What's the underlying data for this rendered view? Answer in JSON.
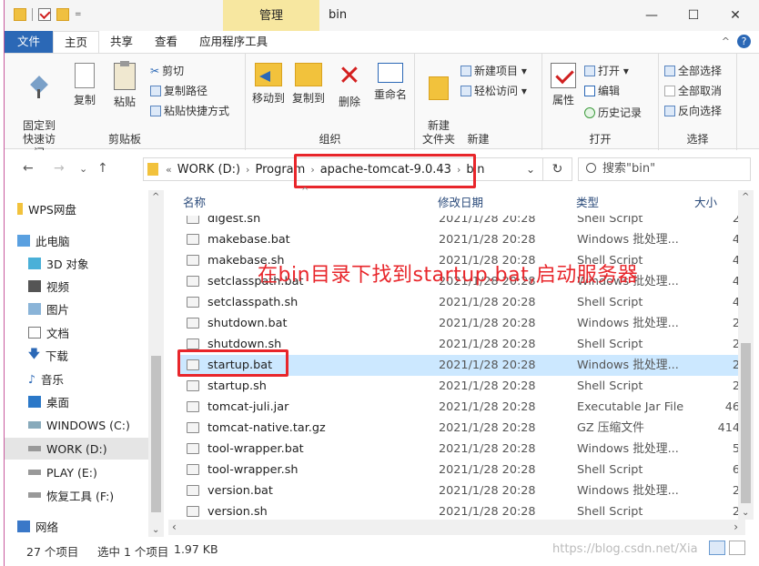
{
  "titlebar": {
    "context_tab": "管理",
    "title": "bin",
    "minimize": "—",
    "maximize": "☐",
    "close": "✕"
  },
  "ribbon_tabs": [
    "文件",
    "主页",
    "共享",
    "查看",
    "应用程序工具"
  ],
  "ribbon": {
    "clipboard": {
      "label": "剪贴板",
      "pin": "固定到\n快速访问",
      "copy": "复制",
      "paste": "粘贴",
      "cut": "剪切",
      "copy_path": "复制路径",
      "paste_shortcut": "粘贴快捷方式"
    },
    "organize": {
      "label": "组织",
      "move_to": "移动到",
      "copy_to": "复制到",
      "delete": "删除",
      "rename": "重命名"
    },
    "new": {
      "label": "新建",
      "new_folder": "新建\n文件夹",
      "new_item": "新建项目 ▾",
      "easy_access": "轻松访问 ▾"
    },
    "open": {
      "label": "打开",
      "properties": "属性",
      "open": "打开 ▾",
      "edit": "编辑",
      "history": "历史记录"
    },
    "select": {
      "label": "选择",
      "select_all": "全部选择",
      "select_none": "全部取消",
      "invert": "反向选择"
    }
  },
  "address": {
    "crumbs": [
      "WORK (D:)",
      "Program",
      "apache-tomcat-9.0.43",
      "bin"
    ],
    "search_placeholder": "搜索\"bin\""
  },
  "nav_items": [
    {
      "label": "WPS网盘",
      "icon": "wps-cloud-icon"
    },
    {
      "label": "此电脑",
      "icon": "computer-icon"
    },
    {
      "label": "3D 对象",
      "icon": "3d-objects-icon"
    },
    {
      "label": "视频",
      "icon": "video-icon"
    },
    {
      "label": "图片",
      "icon": "pictures-icon"
    },
    {
      "label": "文档",
      "icon": "documents-icon"
    },
    {
      "label": "下载",
      "icon": "download-icon"
    },
    {
      "label": "音乐",
      "icon": "music-icon"
    },
    {
      "label": "桌面",
      "icon": "desktop-icon"
    },
    {
      "label": "WINDOWS (C:)",
      "icon": "drive-icon"
    },
    {
      "label": "WORK (D:)",
      "icon": "drive-icon"
    },
    {
      "label": "PLAY (E:)",
      "icon": "drive-icon"
    },
    {
      "label": "恢复工具 (F:)",
      "icon": "drive-icon"
    },
    {
      "label": "网络",
      "icon": "network-icon"
    }
  ],
  "columns": {
    "name": "名称",
    "date": "修改日期",
    "type": "类型",
    "size": "大小"
  },
  "files": [
    {
      "name": "digest.sh",
      "date": "2021/1/28 20:28",
      "type": "Shell Script",
      "size": "2"
    },
    {
      "name": "makebase.bat",
      "date": "2021/1/28 20:28",
      "type": "Windows 批处理...",
      "size": "4"
    },
    {
      "name": "makebase.sh",
      "date": "2021/1/28 20:28",
      "type": "Shell Script",
      "size": "4"
    },
    {
      "name": "setclasspath.bat",
      "date": "2021/1/28 20:28",
      "type": "Windows 批处理...",
      "size": "4"
    },
    {
      "name": "setclasspath.sh",
      "date": "2021/1/28 20:28",
      "type": "Shell Script",
      "size": "4"
    },
    {
      "name": "shutdown.bat",
      "date": "2021/1/28 20:28",
      "type": "Windows 批处理...",
      "size": "2"
    },
    {
      "name": "shutdown.sh",
      "date": "2021/1/28 20:28",
      "type": "Shell Script",
      "size": "2"
    },
    {
      "name": "startup.bat",
      "date": "2021/1/28 20:28",
      "type": "Windows 批处理...",
      "size": "2"
    },
    {
      "name": "startup.sh",
      "date": "2021/1/28 20:28",
      "type": "Shell Script",
      "size": "2"
    },
    {
      "name": "tomcat-juli.jar",
      "date": "2021/1/28 20:28",
      "type": "Executable Jar File",
      "size": "46"
    },
    {
      "name": "tomcat-native.tar.gz",
      "date": "2021/1/28 20:28",
      "type": "GZ 压缩文件",
      "size": "414"
    },
    {
      "name": "tool-wrapper.bat",
      "date": "2021/1/28 20:28",
      "type": "Windows 批处理...",
      "size": "5"
    },
    {
      "name": "tool-wrapper.sh",
      "date": "2021/1/28 20:28",
      "type": "Shell Script",
      "size": "6"
    },
    {
      "name": "version.bat",
      "date": "2021/1/28 20:28",
      "type": "Windows 批处理...",
      "size": "2"
    },
    {
      "name": "version.sh",
      "date": "2021/1/28 20:28",
      "type": "Shell Script",
      "size": "2"
    }
  ],
  "annotation": "在bin目录下找到startup.bat,启动服务器",
  "status": {
    "item_count": "27 个项目",
    "selected": "选中 1 个项目",
    "size": "1.97 KB"
  },
  "watermark": "https://blog.csdn.net/Xia",
  "colors": {
    "accent": "#2b68b6",
    "highlight": "#e8262b",
    "selection": "#cce8ff",
    "context_tab": "#f7e7a0"
  }
}
